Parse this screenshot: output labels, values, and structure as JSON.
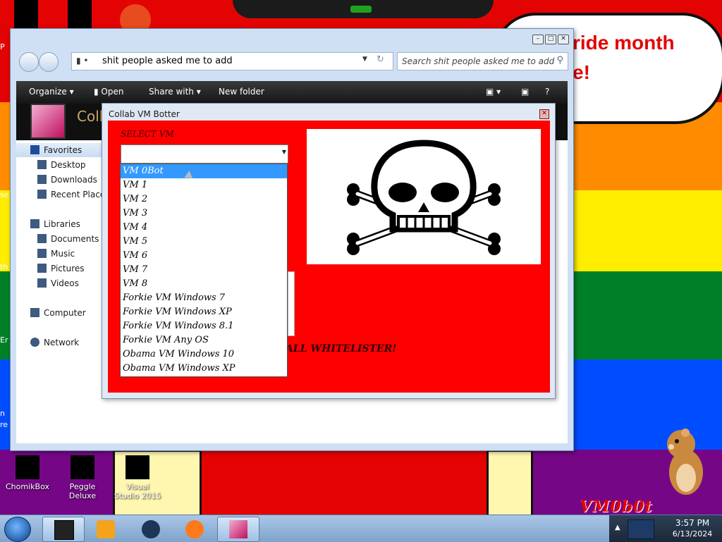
{
  "desktop": {
    "banner_text": "ride month\ne!",
    "left_peek": [
      "P",
      "se",
      "th",
      "Er",
      "n",
      "re"
    ],
    "icons": [
      {
        "label": "ChomikBox"
      },
      {
        "label": "Peggle Deluxe"
      },
      {
        "label": "Visual Studio 2015"
      }
    ],
    "logo_text": "VM0b0t"
  },
  "explorer": {
    "address": "shit people asked me to add",
    "search_placeholder": "Search shit people asked me to add",
    "toolbar": {
      "organize": "Organize ▾",
      "open": "Open",
      "share_with": "Share with ▾",
      "new_folder": "New folder"
    },
    "header_title": "Collab",
    "nav": {
      "favorites": "Favorites",
      "desktop": "Desktop",
      "downloads": "Downloads",
      "recent_places": "Recent Places",
      "libraries": "Libraries",
      "documents": "Documents",
      "music": "Music",
      "pictures": "Pictures",
      "videos": "Videos",
      "computer": "Computer",
      "network": "Network"
    }
  },
  "dialog": {
    "title": "Collab VM Botter",
    "select_label": "SELECT VM",
    "whitelist_text": "ALL WHITELISTER!",
    "dropdown_items": [
      "VM 0Bot",
      "VM 1",
      "VM 2",
      "VM 3",
      "VM 4",
      "VM 5",
      "VM 6",
      "VM 7",
      "VM 8",
      "Forkie VM Windows 7",
      "Forkie VM Windows XP",
      "Forkie VM Windows 8.1",
      "Forkie VM Any OS",
      "Obama VM Windows 10",
      "Obama VM Windows XP"
    ],
    "selected_index": 0
  },
  "taskbar": {
    "time": "3:57 PM",
    "date": "6/13/2024"
  }
}
